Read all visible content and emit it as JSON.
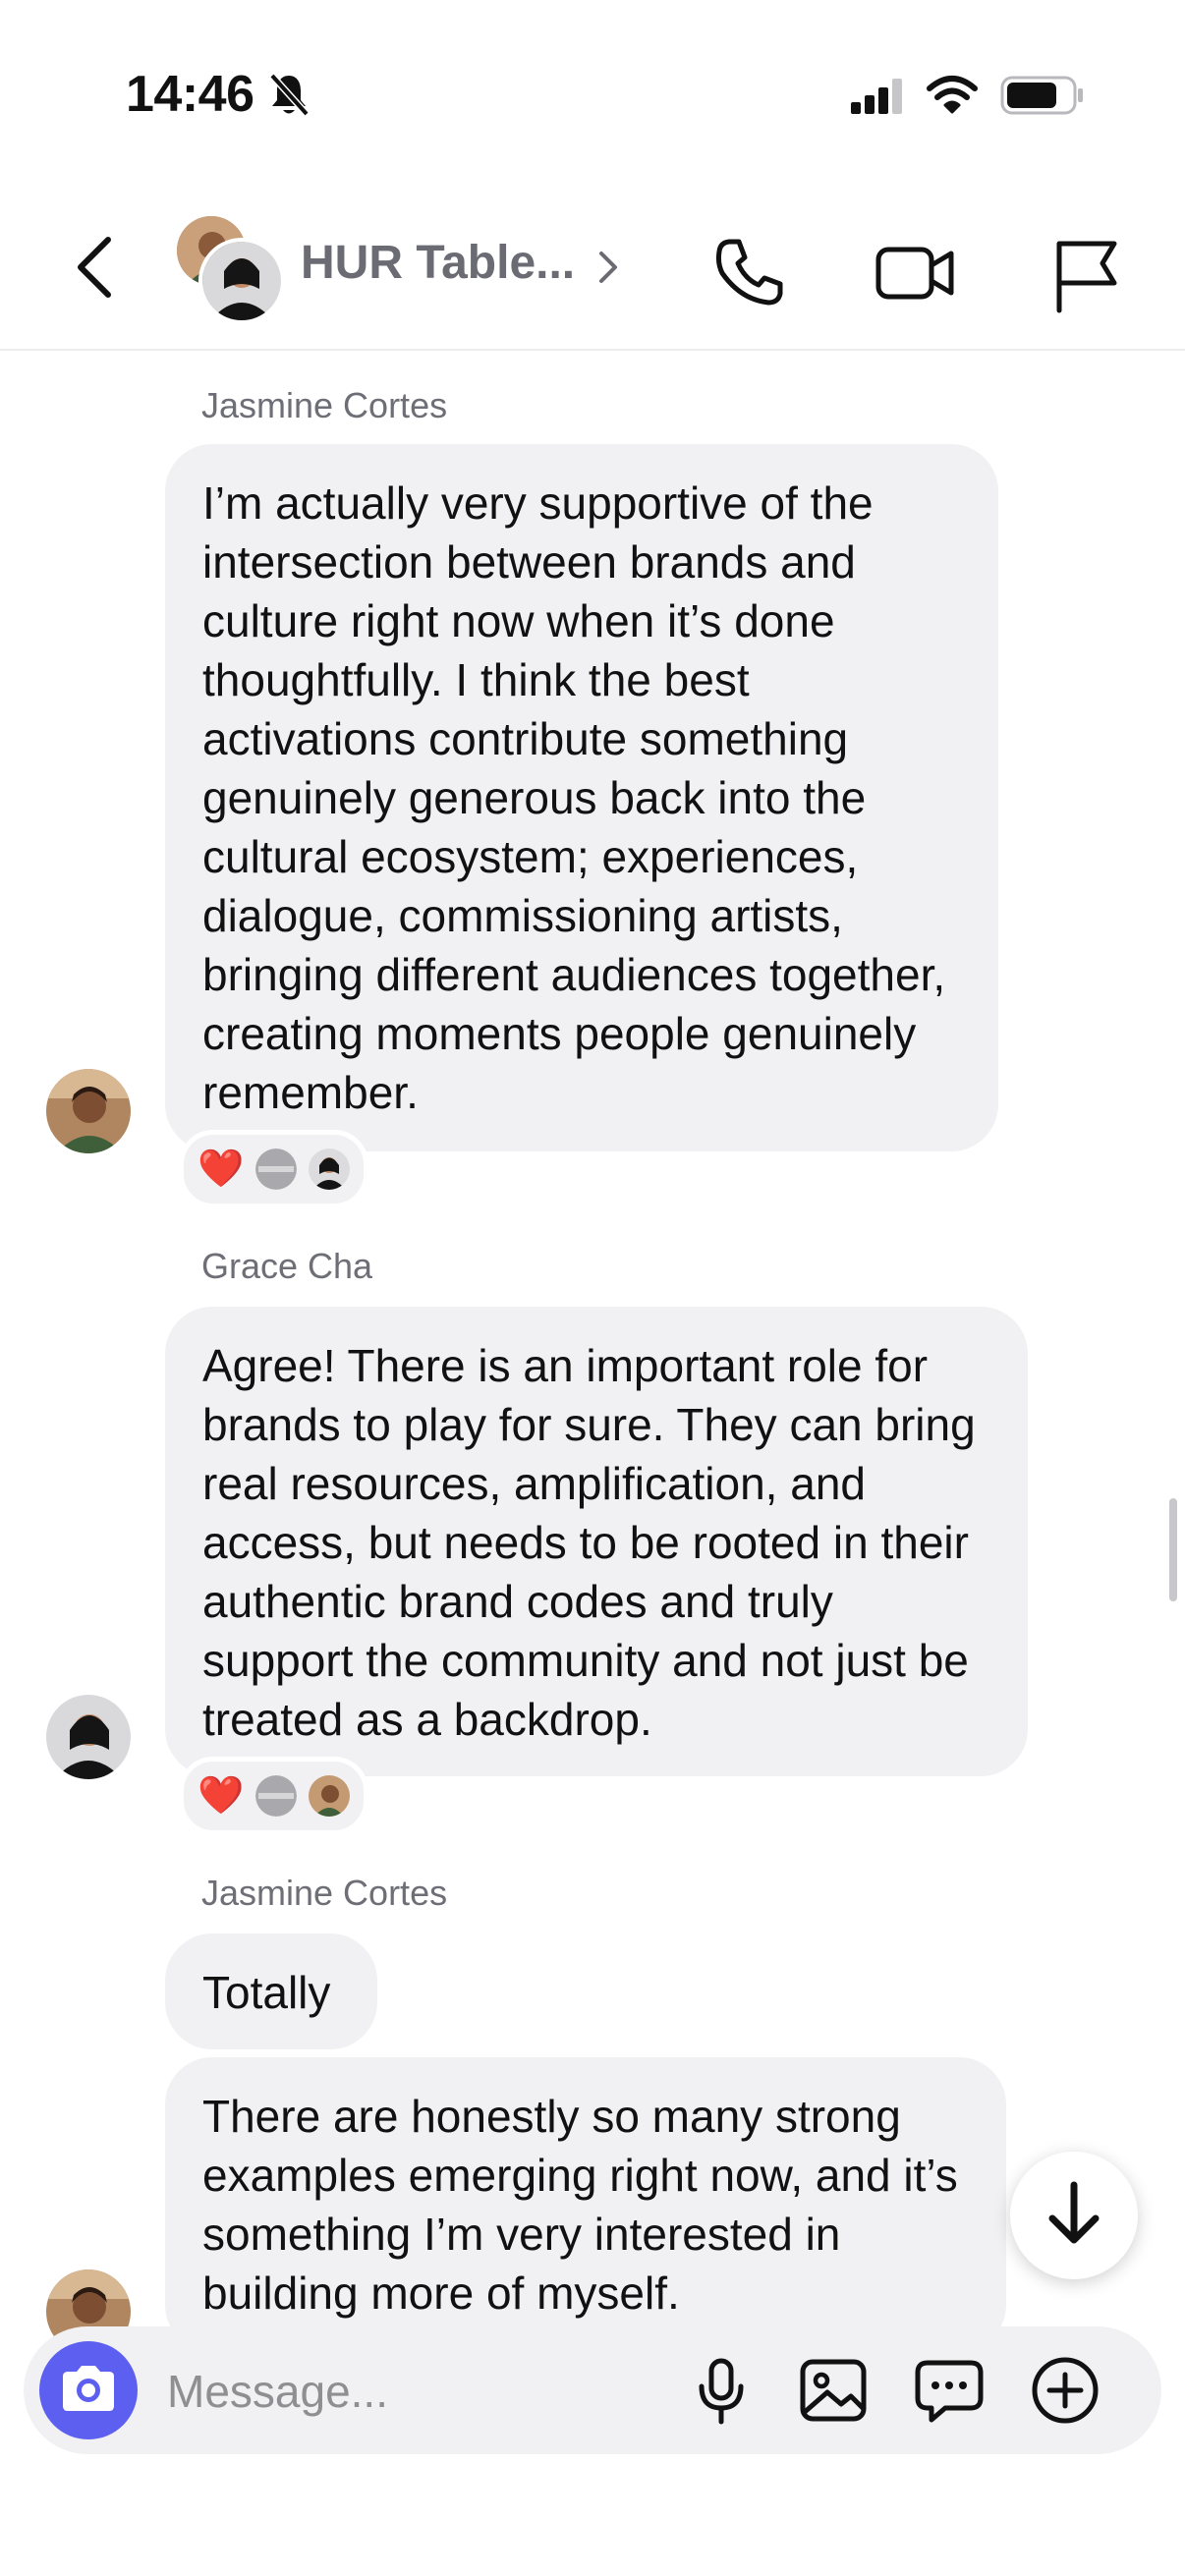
{
  "status_bar": {
    "time": "14:46",
    "icons": [
      "bell-slash-icon",
      "cellular-signal-icon",
      "wifi-icon",
      "battery-icon"
    ]
  },
  "header": {
    "title": "HUR Table...",
    "icons": [
      "back-chevron-icon",
      "chevron-right-icon",
      "phone-icon",
      "video-camera-icon",
      "flag-icon"
    ]
  },
  "messages": [
    {
      "sender": "Jasmine Cortes",
      "bubbles": [
        "I’m actually very supportive of the intersection between brands and culture right now when it’s done thoughtfully. I think the best activations contribute something genuinely generous back into the cultural ecosystem; experiences, dialogue, commissioning artists, bringing different audiences together, creating moments people genuinely remember."
      ],
      "reactions": [
        "❤️"
      ]
    },
    {
      "sender": "Grace Cha",
      "bubbles": [
        "Agree! There is an important role for brands to play for sure. They can bring real resources, amplification, and access, but needs to be rooted in their authentic brand codes and truly support the community and not just be treated as a backdrop."
      ],
      "reactions": [
        "❤️"
      ]
    },
    {
      "sender": "Jasmine Cortes",
      "bubbles": [
        "Totally",
        "There are honestly so many strong examples emerging right now, and it’s something I’m very interested in building more of myself."
      ]
    }
  ],
  "composer": {
    "placeholder": "Message...",
    "icons": [
      "camera-icon",
      "microphone-icon",
      "image-icon",
      "chat-bubble-icon",
      "plus-circle-icon"
    ]
  },
  "colors": {
    "accent": "#5d5ff0",
    "bubble_bg": "#f1f1f3",
    "header_title": "#6b6b73",
    "sender_name": "#6e6e76",
    "heart": "#e0242f"
  }
}
